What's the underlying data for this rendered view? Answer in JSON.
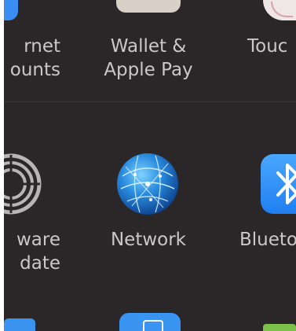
{
  "panes_row1": {
    "internet_accounts": {
      "line1": "rnet",
      "line2": "ounts"
    },
    "wallet_apple_pay": {
      "line1": "Wallet &",
      "line2": "Apple Pay"
    },
    "touch_id": {
      "line1": "Touc"
    }
  },
  "panes_row2": {
    "software_update": {
      "line1": "ware",
      "line2": "date"
    },
    "network": {
      "line1": "Network"
    },
    "bluetooth": {
      "line1": "Blueto"
    }
  },
  "colors": {
    "background": "#2b2628",
    "label": "#cdc7ca",
    "accent_blue": "#1f7ff0"
  },
  "icons": {
    "internet_accounts": "at-sign-icon",
    "wallet": "wallet-icon",
    "touch_id": "fingerprint-icon",
    "software_update": "gear-icon",
    "network": "globe-icon",
    "bluetooth": "bluetooth-icon"
  }
}
